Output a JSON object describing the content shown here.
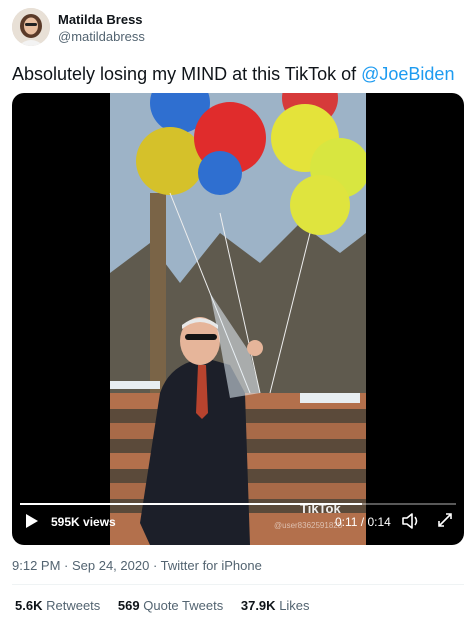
{
  "author": {
    "name": "Matilda Bress",
    "handle": "@matildabress"
  },
  "tweet": {
    "text_before": "Absolutely losing my MIND at this TikTok of ",
    "mention": "@JoeBiden"
  },
  "video": {
    "views": "595K views",
    "timecode": "0:11 / 0:14",
    "progress_fraction": 0.785,
    "watermark": "TikTok",
    "watermark_user": "@user8362591828"
  },
  "meta": {
    "time": "9:12 PM",
    "date": "Sep 24, 2020",
    "source": "Twitter for iPhone",
    "separator": " · "
  },
  "stats": {
    "retweets_count": "5.6K",
    "retweets_label": "Retweets",
    "quotes_count": "569",
    "quotes_label": "Quote Tweets",
    "likes_count": "37.9K",
    "likes_label": "Likes"
  },
  "icons": {
    "avatar": "avatar-photo",
    "play": "play-icon",
    "volume": "volume-icon",
    "fullscreen": "fullscreen-icon"
  }
}
